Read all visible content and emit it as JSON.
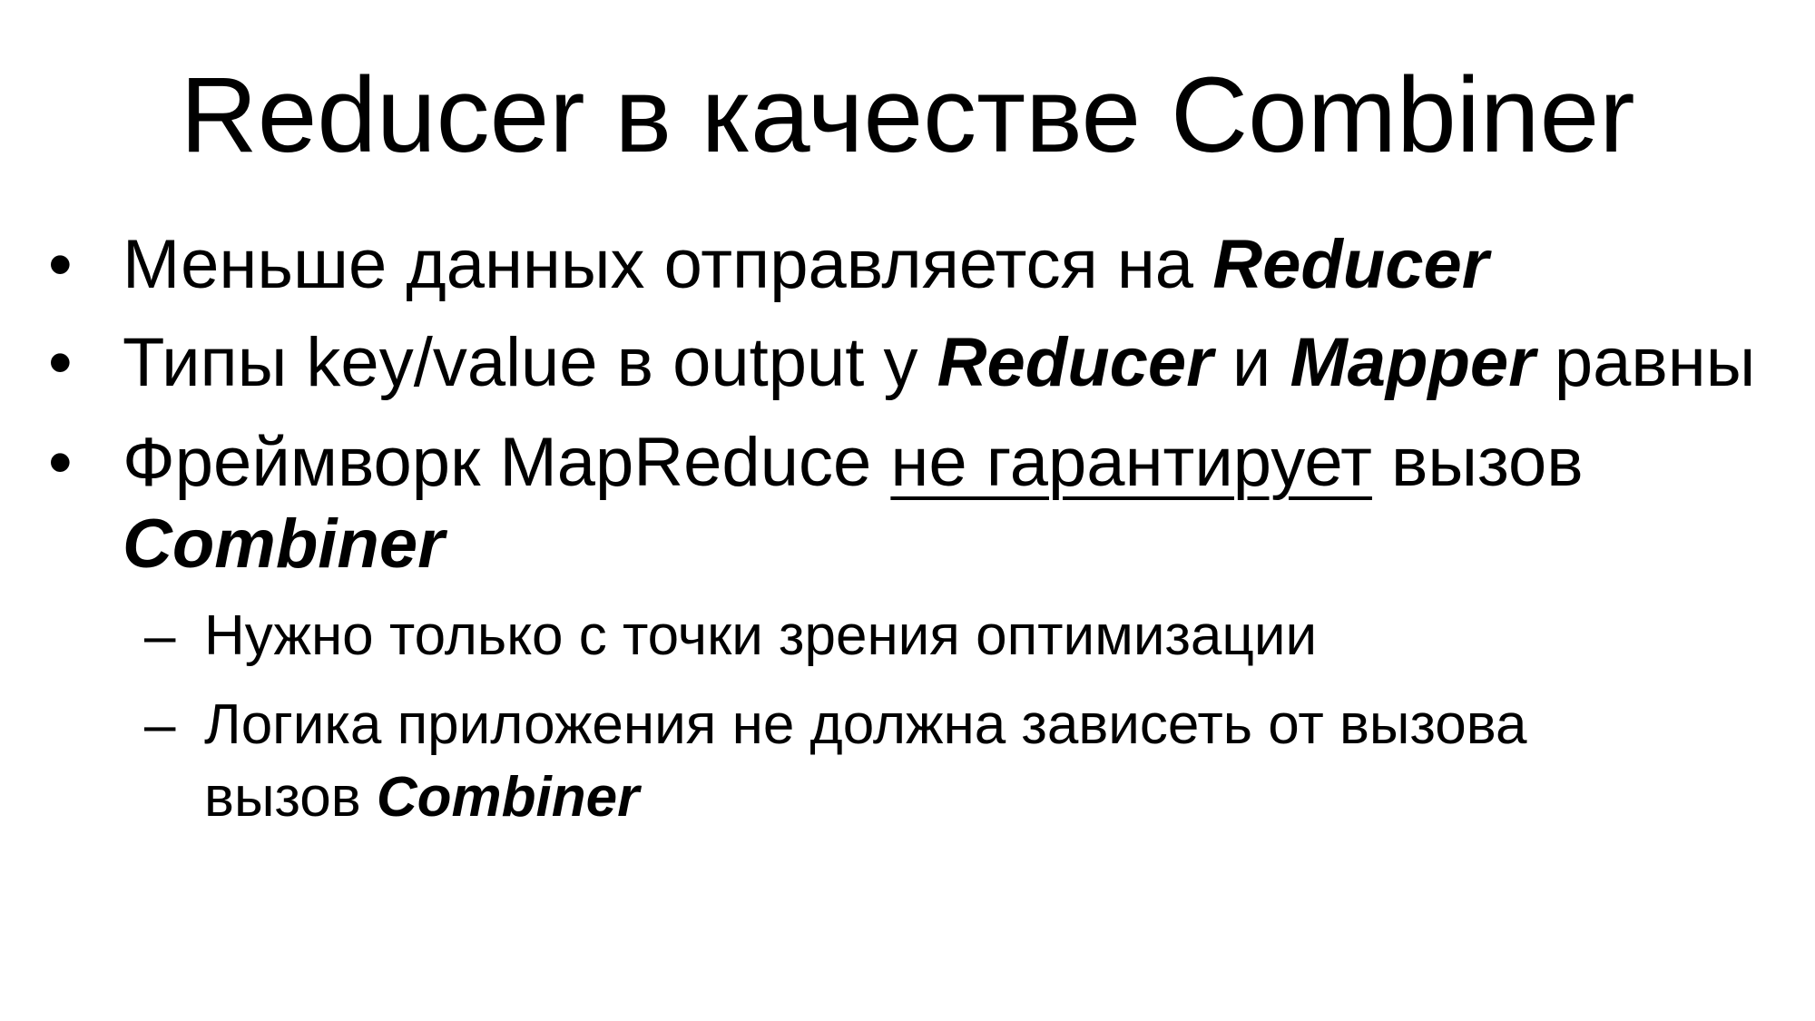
{
  "slide": {
    "title": "Reducer в качестве Combiner",
    "bullet_marker": "•",
    "sub_marker": "–",
    "bullets": [
      {
        "text1": "Меньше данных отправляется на ",
        "bold1": "Reducer"
      },
      {
        "text1": "Типы key/value в output у ",
        "bold1": "Reducer",
        "text2": " и ",
        "bold2": "Mapper",
        "text3": " равны"
      },
      {
        "text1": "Фреймворк MapReduce ",
        "underlined": "не гарантирует",
        "text2": " вызов",
        "bold_line2": "Combiner",
        "sub": [
          {
            "text": "Нужно только с точки зрения оптимизации"
          },
          {
            "line1": "Логика приложения не должна зависеть от вызова",
            "line2_text": "вызов ",
            "line2_bold": "Combiner"
          }
        ]
      }
    ]
  }
}
